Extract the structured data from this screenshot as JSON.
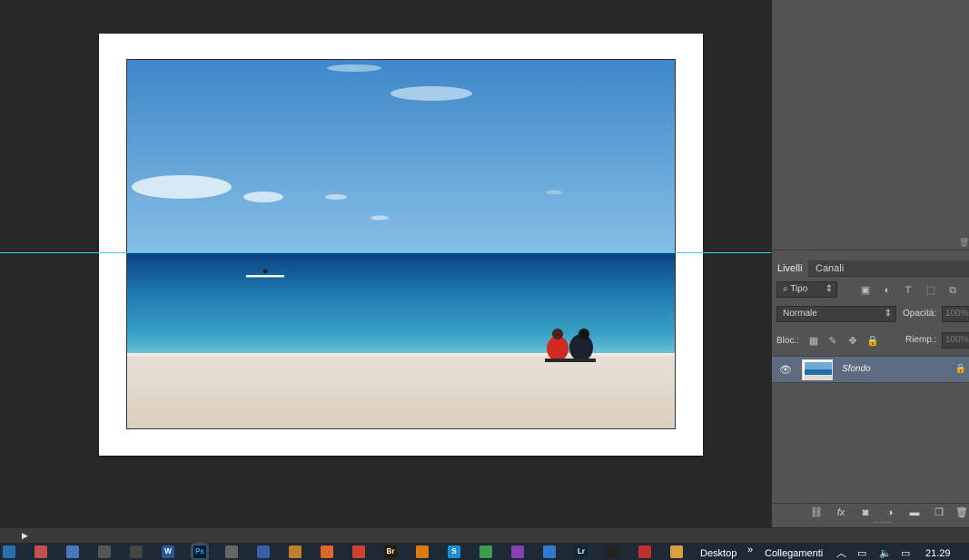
{
  "layers_panel": {
    "tabs": [
      "Livelli",
      "Canali"
    ],
    "filter_label": "Tipo",
    "blend_mode": "Normale",
    "opacity_label": "Opacità:",
    "opacity_value": "100%",
    "lock_label": "Bloc.:",
    "fill_label": "Riemp.:",
    "fill_value": "100%",
    "layer_name": "Sfondo",
    "filter_icons": [
      "image-icon",
      "adjust-icon",
      "type-icon",
      "shape-icon",
      "smart-object-icon"
    ],
    "bottom_icons": [
      "link-icon",
      "fx-icon",
      "mask-icon",
      "adjustment-layer-icon",
      "folder-icon",
      "new-layer-icon",
      "trash-icon"
    ]
  },
  "taskbar": {
    "desktop_label": "Desktop",
    "links_label": "Collegamenti",
    "clock": "21.29",
    "apps": [
      {
        "name": "start-icon",
        "label": "",
        "color": "#2a6fb0"
      },
      {
        "name": "paint-icon",
        "label": "",
        "color": "#c05050"
      },
      {
        "name": "notepad-icon",
        "label": "",
        "color": "#4a78c0"
      },
      {
        "name": "calculator-icon",
        "label": "",
        "color": "#555"
      },
      {
        "name": "camera-icon",
        "label": "",
        "color": "#444"
      },
      {
        "name": "word-icon",
        "label": "W",
        "color": "#2b579a"
      },
      {
        "name": "photoshop-icon",
        "label": "Ps",
        "color": "#001d34"
      },
      {
        "name": "cat-icon",
        "label": "",
        "color": "#666"
      },
      {
        "name": "app-icon",
        "label": "",
        "color": "#3b5ea8"
      },
      {
        "name": "brush-icon",
        "label": "",
        "color": "#c08030"
      },
      {
        "name": "firefox-icon",
        "label": "",
        "color": "#e0662b"
      },
      {
        "name": "ccleaner-icon",
        "label": "",
        "color": "#d04030"
      },
      {
        "name": "bridge-icon",
        "label": "Br",
        "color": "#2a1a00"
      },
      {
        "name": "vlc-icon",
        "label": "",
        "color": "#e07a10"
      },
      {
        "name": "skype-icon",
        "label": "S",
        "color": "#1a8fd6"
      },
      {
        "name": "chrome-icon",
        "label": "",
        "color": "#3a9d4a"
      },
      {
        "name": "editor-icon",
        "label": "",
        "color": "#8a3fb0"
      },
      {
        "name": "globe-icon",
        "label": "",
        "color": "#2f7bd1"
      },
      {
        "name": "lightroom-icon",
        "label": "Lr",
        "color": "#12243a"
      },
      {
        "name": "steam-icon",
        "label": "",
        "color": "#222"
      },
      {
        "name": "scissors-icon",
        "label": "",
        "color": "#c03030"
      },
      {
        "name": "explorer-icon",
        "label": "",
        "color": "#d8a040"
      }
    ]
  },
  "colors": {
    "guide": "#35d2e8",
    "workspace": "#282828",
    "panel": "#535353",
    "layer_selected": "#5d6b80"
  }
}
